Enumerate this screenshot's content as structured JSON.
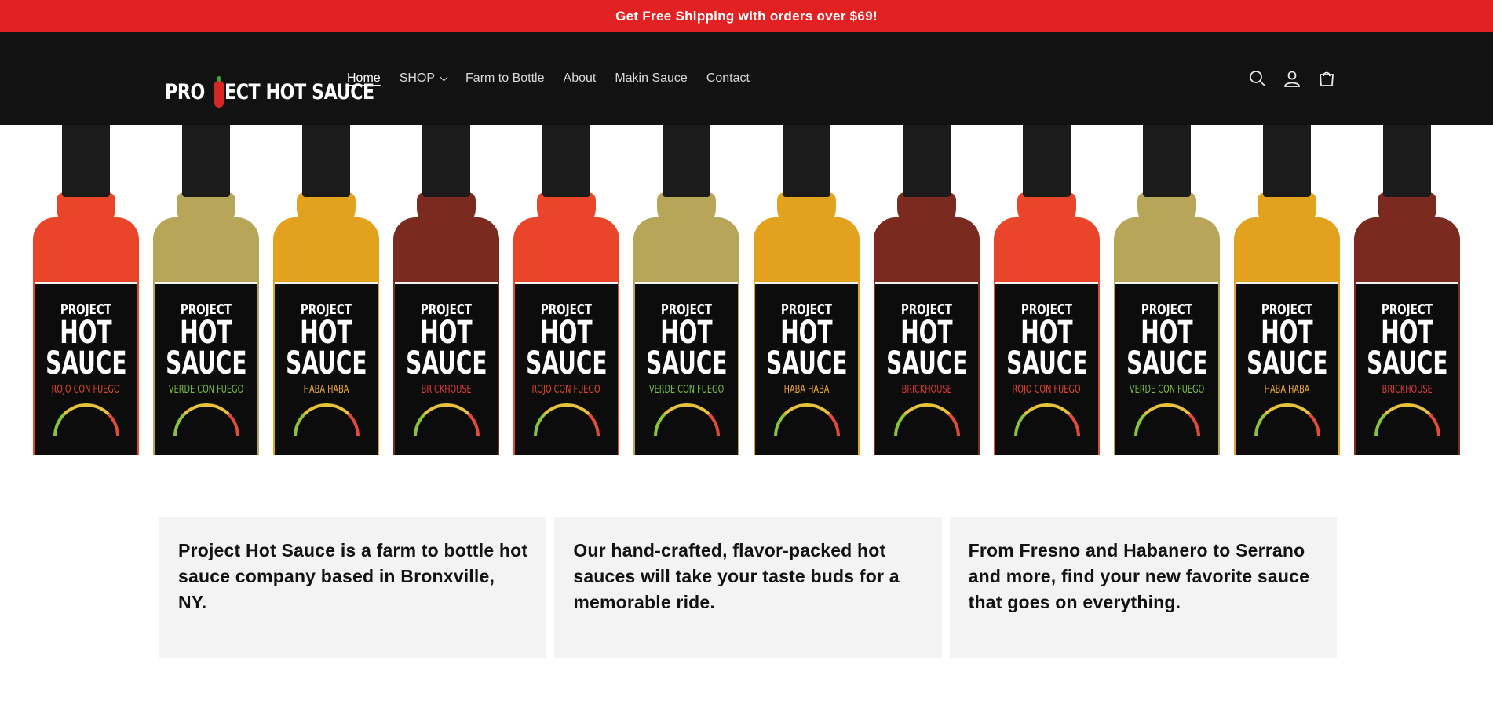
{
  "announcement": {
    "text": "Get Free Shipping with orders over $69!"
  },
  "header": {
    "logo": {
      "part1": "PRO",
      "part2": "ECT HOT SAUCE"
    },
    "nav": [
      {
        "label": "Home",
        "active": true
      },
      {
        "label": "SHOP",
        "has_dropdown": true
      },
      {
        "label": "Farm to Bottle"
      },
      {
        "label": "About"
      },
      {
        "label": "Makin Sauce"
      },
      {
        "label": "Contact"
      }
    ],
    "icons": [
      "search-icon",
      "account-icon",
      "cart-icon"
    ]
  },
  "banner": {
    "brand": {
      "line1": "PROJECT",
      "line2": "HOT",
      "line3": "SAUCE"
    },
    "bottles": [
      {
        "flavor": "ROJO CON FUEGO",
        "sauce_color": "#e8452a",
        "flavor_color": "#e8452a"
      },
      {
        "flavor": "VERDE CON FUEGO",
        "sauce_color": "#b7a55a",
        "flavor_color": "#7bc043"
      },
      {
        "flavor": "HABA HABA",
        "sauce_color": "#e2a21e",
        "flavor_color": "#f0a830"
      },
      {
        "flavor": "BRICKHOUSE",
        "sauce_color": "#7a2a1e",
        "flavor_color": "#e03a3a"
      },
      {
        "flavor": "ROJO CON FUEGO",
        "sauce_color": "#e8452a",
        "flavor_color": "#e8452a"
      },
      {
        "flavor": "VERDE CON FUEGO",
        "sauce_color": "#b7a55a",
        "flavor_color": "#7bc043"
      },
      {
        "flavor": "HABA HABA",
        "sauce_color": "#e2a21e",
        "flavor_color": "#f0a830"
      },
      {
        "flavor": "BRICKHOUSE",
        "sauce_color": "#7a2a1e",
        "flavor_color": "#e03a3a"
      },
      {
        "flavor": "ROJO CON FUEGO",
        "sauce_color": "#e8452a",
        "flavor_color": "#e8452a"
      },
      {
        "flavor": "VERDE CON FUEGO",
        "sauce_color": "#b7a55a",
        "flavor_color": "#7bc043"
      },
      {
        "flavor": "HABA HABA",
        "sauce_color": "#e2a21e",
        "flavor_color": "#f0a830"
      },
      {
        "flavor": "BRICKHOUSE",
        "sauce_color": "#7a2a1e",
        "flavor_color": "#e03a3a"
      }
    ]
  },
  "features": [
    {
      "text": "Project Hot Sauce is a farm to bottle hot sauce company based in Bronxville, NY."
    },
    {
      "text": "Our hand-crafted, flavor-packed hot sauces will take your taste buds for a memorable ride."
    },
    {
      "text": "From Fresno and Habanero to Serrano and more, find your new favorite sauce that goes on everything."
    }
  ],
  "colors": {
    "announcement_bg": "#e22222",
    "header_bg": "#121212",
    "card_bg": "#f3f3f3"
  }
}
